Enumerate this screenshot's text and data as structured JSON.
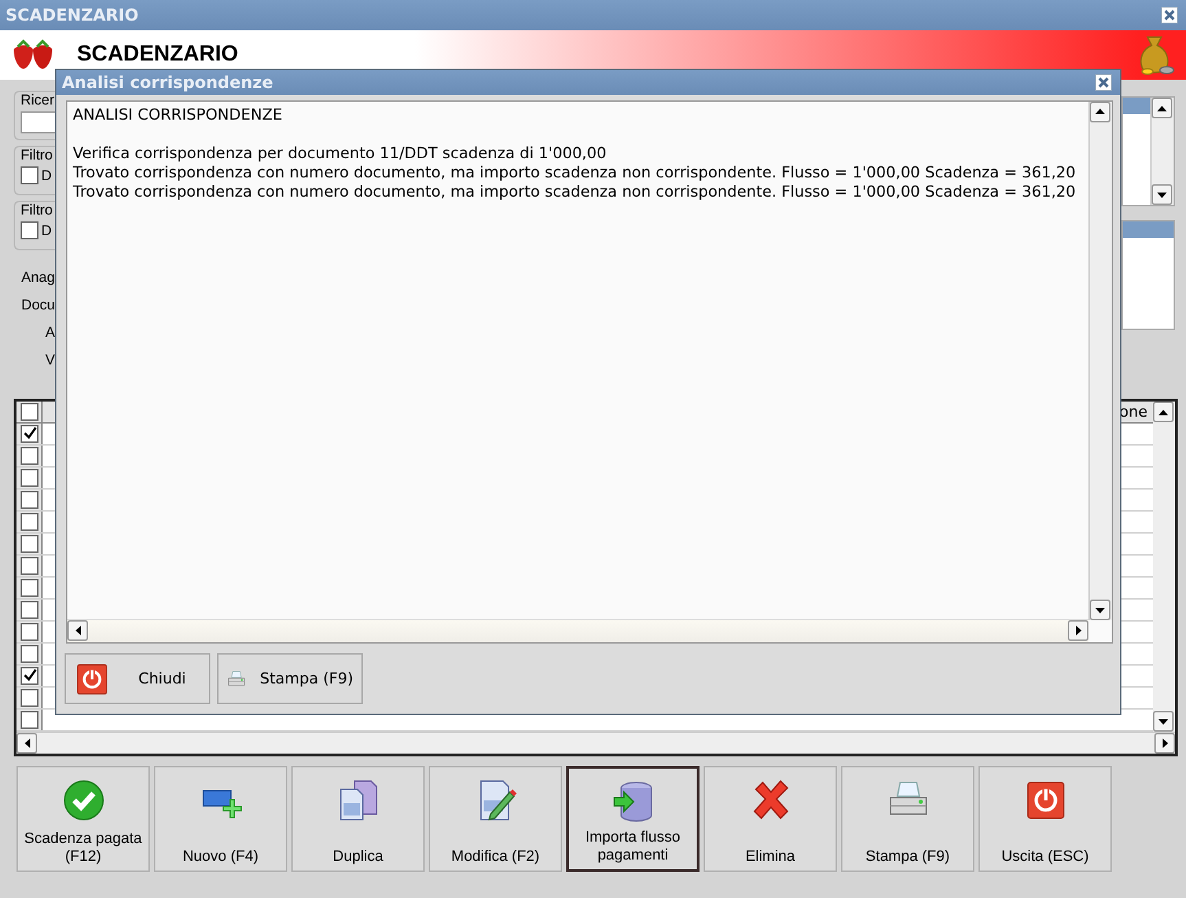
{
  "window": {
    "title": "SCADENZARIO",
    "header": "SCADENZARIO"
  },
  "filters": {
    "search_label": "Ricer",
    "filter_1": {
      "label": "Filtro",
      "option": "D",
      "checked": false
    },
    "filter_2": {
      "label": "Filtro",
      "option": "D",
      "checked": false
    }
  },
  "fields": [
    "Anag",
    "Docu",
    "A",
    "V"
  ],
  "table": {
    "select_all": false,
    "column_header": "one",
    "rows": [
      {
        "checked": true
      },
      {
        "checked": false
      },
      {
        "checked": false
      },
      {
        "checked": false
      },
      {
        "checked": false
      },
      {
        "checked": false
      },
      {
        "checked": false
      },
      {
        "checked": false
      },
      {
        "checked": false
      },
      {
        "checked": false
      },
      {
        "checked": false
      },
      {
        "checked": true
      },
      {
        "checked": false
      },
      {
        "checked": false
      }
    ]
  },
  "toolbar": [
    {
      "kind": "confirm",
      "label": "Scadenza pagata (F12)",
      "focused": false
    },
    {
      "kind": "new",
      "label": "Nuovo (F4)",
      "focused": false
    },
    {
      "kind": "duplicate",
      "label": "Duplica",
      "focused": false
    },
    {
      "kind": "edit",
      "label": "Modifica (F2)",
      "focused": false
    },
    {
      "kind": "import",
      "label": "Importa flusso pagamenti",
      "focused": true
    },
    {
      "kind": "delete",
      "label": "Elimina",
      "focused": false
    },
    {
      "kind": "print",
      "label": "Stampa (F9)",
      "focused": false
    },
    {
      "kind": "exit",
      "label": "Uscita (ESC)",
      "focused": false
    }
  ],
  "dialog": {
    "title": "Analisi corrispondenze",
    "heading": "ANALISI CORRISPONDENZE",
    "lines": [
      "Verifica corrispondenza per documento 11/DDT scadenza di 1'000,00",
      "Trovato corrispondenza con numero documento, ma importo scadenza non corrispondente. Flusso = 1'000,00 Scadenza = 361,20",
      "Trovato corrispondenza con numero documento, ma importo scadenza non corrispondente. Flusso = 1'000,00 Scadenza = 361,20"
    ],
    "buttons": [
      {
        "kind": "exit",
        "label": "Chiudi"
      },
      {
        "kind": "print",
        "label": "Stampa (F9)"
      }
    ]
  }
}
